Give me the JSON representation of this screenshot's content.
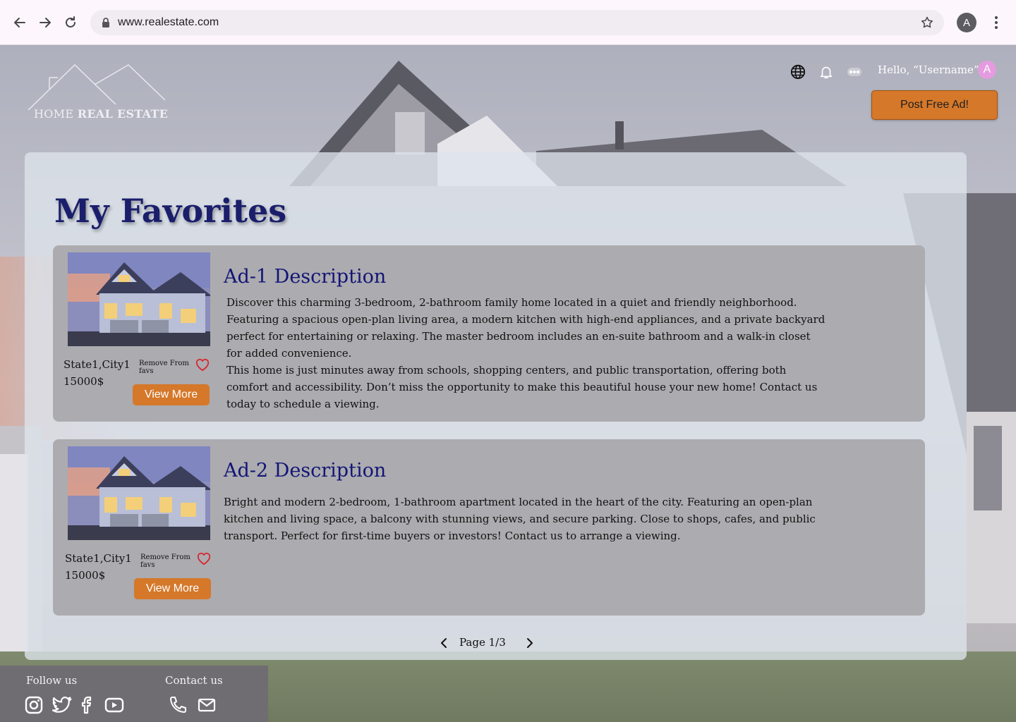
{
  "browser": {
    "url": "www.realestate.com",
    "profile_initial": "A"
  },
  "header": {
    "logo_text_light": "HOME ",
    "logo_text_bold": "REAL ESTATE",
    "greeting": "Hello, “Username”",
    "avatar_initial": "A",
    "post_button": "Post Free Ad!"
  },
  "main": {
    "title": "My Favorites",
    "ads": [
      {
        "location": "State1,City1",
        "price": "15000$",
        "remove_label": "Remove From favs",
        "view_more": "View More",
        "title": "Ad-1 Description",
        "description_p1": "Discover this charming 3-bedroom, 2-bathroom family home located in a quiet and friendly neighborhood. Featuring a spacious open-plan living area, a modern kitchen with high-end appliances, and a private backyard perfect for entertaining or relaxing. The master bedroom includes an en-suite bathroom and a walk-in closet for added convenience.",
        "description_p2": "This home is just minutes away from schools, shopping centers, and public transportation, offering both comfort and accessibility. Don’t miss the opportunity to make this beautiful house your new home! Contact us today to schedule a viewing."
      },
      {
        "location": "State1,City1",
        "price": "15000$",
        "remove_label": "Remove From favs",
        "view_more": "View More",
        "title": "Ad-2 Description",
        "description_p1": "Bright and modern 2-bedroom, 1-bathroom apartment located in the heart of the city. Featuring an open-plan kitchen and living space, a balcony with stunning views, and secure parking. Close to shops, cafes, and public transport. Perfect for first-time buyers or investors! Contact us to arrange a viewing."
      }
    ],
    "pagination": {
      "label": "Page 1/3"
    }
  },
  "footer": {
    "follow_label": "Follow us",
    "contact_label": "Contact us"
  },
  "colors": {
    "accent": "#d5782a",
    "title_navy": "#1a1e6b",
    "heart": "#d8262e"
  }
}
